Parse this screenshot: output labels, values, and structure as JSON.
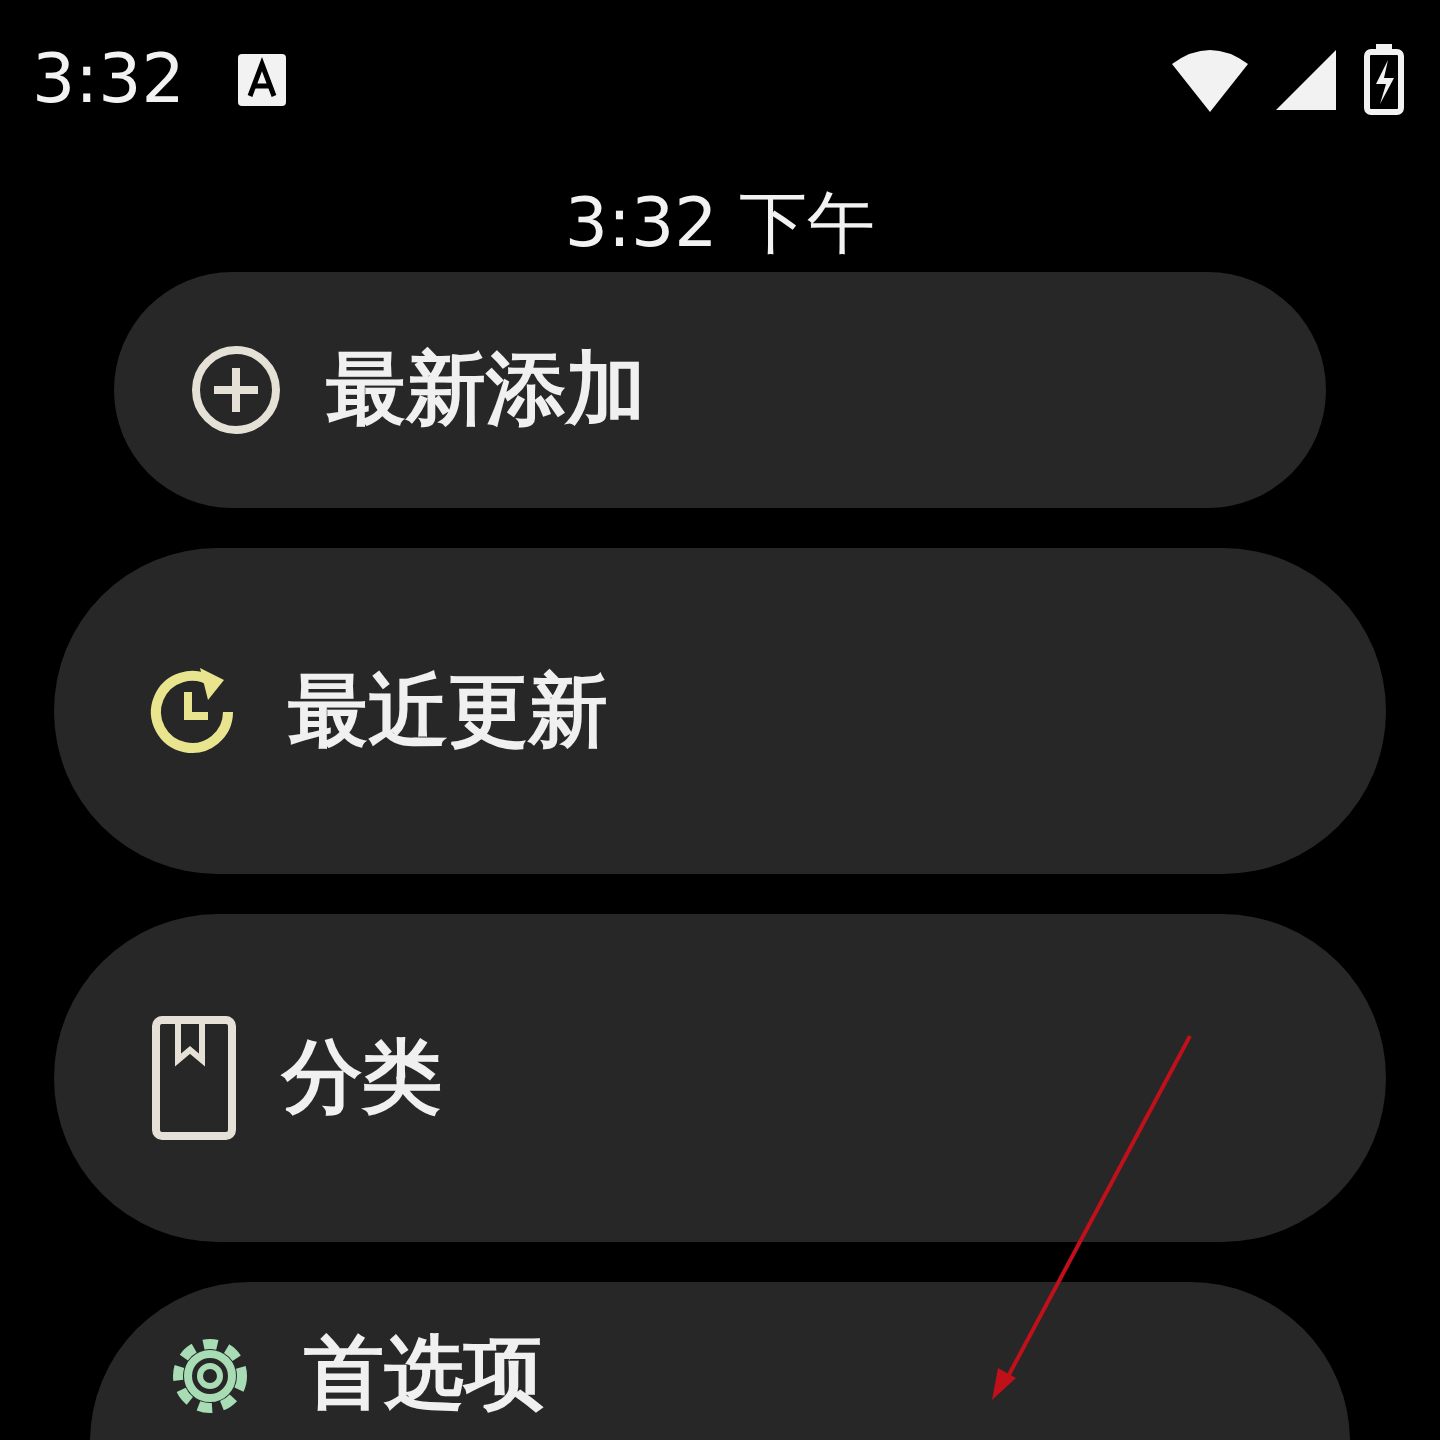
{
  "status_bar": {
    "time": "3:32"
  },
  "clock": "3:32 下午",
  "menu": [
    {
      "kind": "add",
      "label": "最新添加",
      "color": "#e6e1d6"
    },
    {
      "kind": "recent",
      "label": "最近更新",
      "color": "#e9e58f"
    },
    {
      "kind": "category",
      "label": "分类",
      "color": "#e6e1d6"
    },
    {
      "kind": "settings",
      "label": "首选项",
      "color": "#a8dcb4"
    }
  ]
}
